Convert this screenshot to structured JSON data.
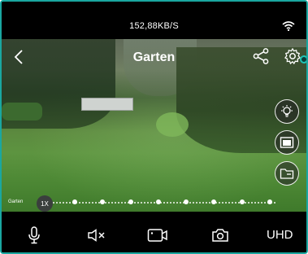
{
  "status": {
    "data_rate": "152,88KB/S"
  },
  "nav": {
    "title": "Garten"
  },
  "video": {
    "overlay_label": "Garten"
  },
  "zoom": {
    "level": "1X",
    "steps": 8,
    "position_fraction": 0
  },
  "bottom": {
    "quality_label": "UHD"
  },
  "icons": {
    "back": "chevron-left-icon",
    "share": "share-icon",
    "settings": "gear-icon",
    "brightness": "lightbulb-icon",
    "picture_in_picture": "pip-icon",
    "folder": "folder-icon",
    "mic": "microphone-icon",
    "mute": "speaker-mute-icon",
    "record": "video-record-icon",
    "snapshot": "camera-icon",
    "wifi": "wifi-icon"
  },
  "colors": {
    "accent": "#1fc4b6",
    "frame_border": "#1aa7a0"
  }
}
